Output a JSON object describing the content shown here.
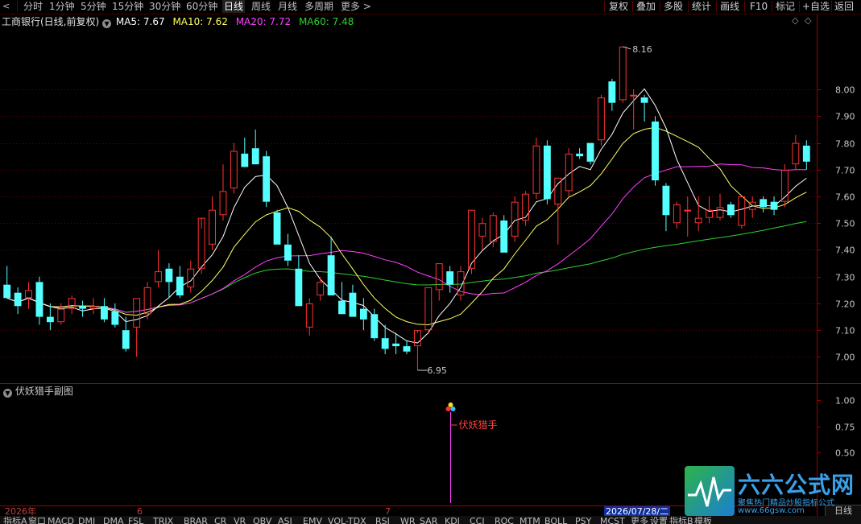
{
  "toolbar": {
    "periods": [
      "分时",
      "1分钟",
      "5分钟",
      "15分钟",
      "30分钟",
      "60分钟",
      "日线",
      "周线",
      "月线",
      "多周期",
      "更多 >"
    ],
    "active_period": "日线",
    "tools": [
      "复权",
      "叠加",
      "多股",
      "统计",
      "画线",
      "F10",
      "标记",
      "+自选",
      "返回"
    ]
  },
  "main_chart": {
    "title": "工商银行(日线,前复权)",
    "ma": [
      {
        "label": "MA5: 7.67",
        "color": "#ffffff"
      },
      {
        "label": "MA10: 7.62",
        "color": "#ffff66"
      },
      {
        "label": "MA20: 7.72",
        "color": "#ff40ff"
      },
      {
        "label": "MA60: 7.48",
        "color": "#30d030"
      }
    ],
    "high_label": "8.16",
    "low_label": "6.95"
  },
  "sub_chart": {
    "title": "伏妖猎手副图",
    "signal_label": "伏妖猎手"
  },
  "date_axis": {
    "labels": [
      "2026年",
      "6",
      "7"
    ],
    "cursor_date": "2026/07/28/二",
    "freq_label": "日线"
  },
  "bottom_tabs": [
    "指标A",
    "窗口",
    "MACD",
    "DMI",
    "DMA",
    "FSL",
    "TRIX",
    "BRAR",
    "CR",
    "VR",
    "OBV",
    "ASI",
    "EMV",
    "VOL-TDX",
    "RSI",
    "WR",
    "SAR",
    "KDJ",
    "CCI",
    "ROC",
    "MTM",
    "BOLL",
    "PSY",
    "MCST",
    "更多",
    "设置",
    "指标B",
    "模板"
  ],
  "watermark": {
    "title": "六六公式网",
    "subtitle": "聚焦热门精品炒股指标公式",
    "url": "www.66gsw.com"
  },
  "chart_data": {
    "type": "candlestick",
    "y_ticks": [
      7.0,
      7.1,
      7.2,
      7.3,
      7.4,
      7.5,
      7.6,
      7.7,
      7.8,
      7.9,
      8.0
    ],
    "ylim": [
      6.92,
      8.22
    ],
    "colors": {
      "up": "#ff3232",
      "down": "#54ffff"
    },
    "candles": [
      [
        7.27,
        7.34,
        7.22,
        7.22
      ],
      [
        7.24,
        7.26,
        7.16,
        7.19
      ],
      [
        7.22,
        7.28,
        7.18,
        7.25
      ],
      [
        7.28,
        7.3,
        7.12,
        7.15
      ],
      [
        7.15,
        7.2,
        7.1,
        7.13
      ],
      [
        7.13,
        7.2,
        7.12,
        7.18
      ],
      [
        7.18,
        7.23,
        7.16,
        7.22
      ],
      [
        7.19,
        7.21,
        7.15,
        7.18
      ],
      [
        7.18,
        7.22,
        7.16,
        7.19
      ],
      [
        7.19,
        7.22,
        7.13,
        7.14
      ],
      [
        7.17,
        7.2,
        7.11,
        7.12
      ],
      [
        7.1,
        7.15,
        7.02,
        7.03
      ],
      [
        7.11,
        7.22,
        7.0,
        7.22
      ],
      [
        7.16,
        7.28,
        7.14,
        7.26
      ],
      [
        7.28,
        7.4,
        7.26,
        7.32
      ],
      [
        7.33,
        7.35,
        7.22,
        7.28
      ],
      [
        7.3,
        7.34,
        7.22,
        7.23
      ],
      [
        7.26,
        7.36,
        7.24,
        7.33
      ],
      [
        7.33,
        7.48,
        7.31,
        7.52
      ],
      [
        7.42,
        7.6,
        7.4,
        7.55
      ],
      [
        7.53,
        7.72,
        7.51,
        7.62
      ],
      [
        7.63,
        7.8,
        7.61,
        7.77
      ],
      [
        7.76,
        7.82,
        7.73,
        7.71
      ],
      [
        7.78,
        7.85,
        7.75,
        7.72
      ],
      [
        7.75,
        7.77,
        7.56,
        7.58
      ],
      [
        7.54,
        7.55,
        7.42,
        7.42
      ],
      [
        7.42,
        7.46,
        7.34,
        7.36
      ],
      [
        7.33,
        7.38,
        7.19,
        7.19
      ],
      [
        7.11,
        7.22,
        7.08,
        7.2
      ],
      [
        7.23,
        7.3,
        7.21,
        7.28
      ],
      [
        7.38,
        7.45,
        7.23,
        7.23
      ],
      [
        7.21,
        7.28,
        7.16,
        7.16
      ],
      [
        7.24,
        7.27,
        7.15,
        7.15
      ],
      [
        7.18,
        7.22,
        7.1,
        7.14
      ],
      [
        7.16,
        7.18,
        7.06,
        7.07
      ],
      [
        7.07,
        7.12,
        7.01,
        7.03
      ],
      [
        7.05,
        7.09,
        7.01,
        7.04
      ],
      [
        7.04,
        7.06,
        7.01,
        7.02
      ],
      [
        7.04,
        7.09,
        6.95,
        7.1
      ],
      [
        7.1,
        7.26,
        7.09,
        7.26
      ],
      [
        7.25,
        7.35,
        7.21,
        7.35
      ],
      [
        7.32,
        7.34,
        7.24,
        7.27
      ],
      [
        7.23,
        7.34,
        7.21,
        7.32
      ],
      [
        7.33,
        7.55,
        7.31,
        7.55
      ],
      [
        7.45,
        7.52,
        7.4,
        7.5
      ],
      [
        7.43,
        7.54,
        7.41,
        7.53
      ],
      [
        7.51,
        7.53,
        7.39,
        7.39
      ],
      [
        7.45,
        7.6,
        7.43,
        7.58
      ],
      [
        7.51,
        7.62,
        7.49,
        7.61
      ],
      [
        7.61,
        7.82,
        7.59,
        7.79
      ],
      [
        7.79,
        7.81,
        7.57,
        7.59
      ],
      [
        7.57,
        7.67,
        7.42,
        7.67
      ],
      [
        7.62,
        7.78,
        7.6,
        7.76
      ],
      [
        7.76,
        7.78,
        7.74,
        7.75
      ],
      [
        7.8,
        7.8,
        7.72,
        7.73
      ],
      [
        7.81,
        7.98,
        7.79,
        7.97
      ],
      [
        8.03,
        8.04,
        7.92,
        7.95
      ],
      [
        7.96,
        8.16,
        7.95,
        8.16
      ],
      [
        7.98,
        8.0,
        7.85,
        7.98
      ],
      [
        7.97,
        7.98,
        7.88,
        7.95
      ],
      [
        7.88,
        7.9,
        7.64,
        7.66
      ],
      [
        7.64,
        7.65,
        7.47,
        7.53
      ],
      [
        7.5,
        7.58,
        7.48,
        7.57
      ],
      [
        7.55,
        7.6,
        7.45,
        7.55
      ],
      [
        7.5,
        7.6,
        7.47,
        7.52
      ],
      [
        7.52,
        7.6,
        7.5,
        7.55
      ],
      [
        7.52,
        7.61,
        7.51,
        7.56
      ],
      [
        7.57,
        7.58,
        7.52,
        7.53
      ],
      [
        7.49,
        7.6,
        7.48,
        7.6
      ],
      [
        7.55,
        7.6,
        7.52,
        7.58
      ],
      [
        7.59,
        7.6,
        7.54,
        7.56
      ],
      [
        7.58,
        7.6,
        7.53,
        7.55
      ],
      [
        7.58,
        7.72,
        7.56,
        7.7
      ],
      [
        7.72,
        7.83,
        7.7,
        7.8
      ],
      [
        7.79,
        7.81,
        7.7,
        7.73
      ]
    ],
    "sub_axis_ticks": [
      0.5,
      0.75,
      1.0
    ],
    "signal_index": 60
  }
}
